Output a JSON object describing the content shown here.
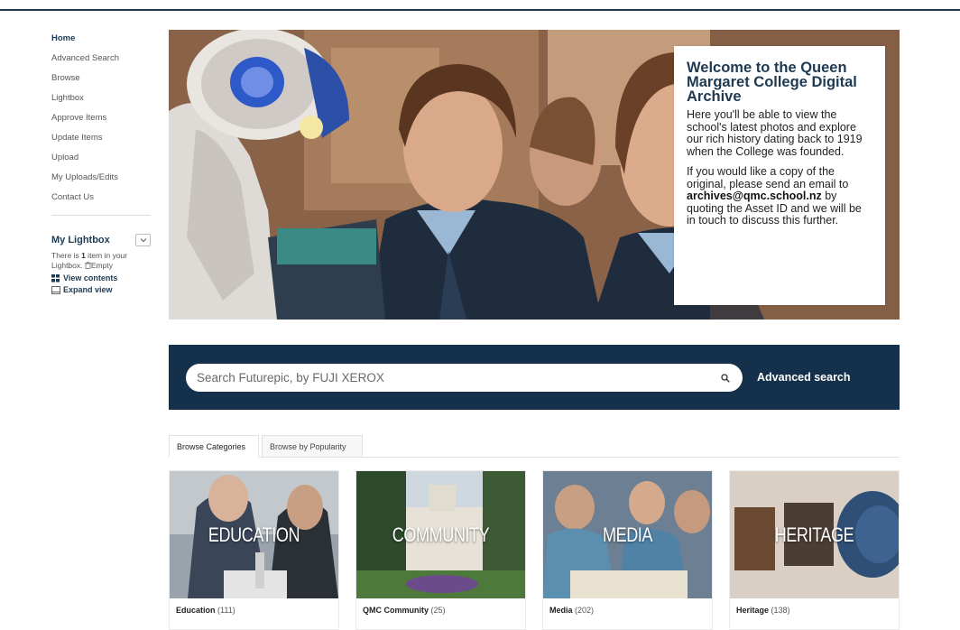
{
  "sidebar": {
    "nav": [
      {
        "label": "Home",
        "active": true
      },
      {
        "label": "Advanced Search",
        "active": false
      },
      {
        "label": "Browse",
        "active": false
      },
      {
        "label": "Lightbox",
        "active": false
      },
      {
        "label": "Approve Items",
        "active": false
      },
      {
        "label": "Update Items",
        "active": false
      },
      {
        "label": "Upload",
        "active": false
      },
      {
        "label": "My Uploads/Edits",
        "active": false
      },
      {
        "label": "Contact Us",
        "active": false
      }
    ],
    "lightbox": {
      "title": "My Lightbox",
      "text_before": "There is ",
      "count": "1",
      "text_after": " item in your Lightbox.",
      "empty_label": "Empty",
      "view_contents": "View contents",
      "expand_view": "Expand view"
    }
  },
  "welcome": {
    "title": "Welcome to the Queen Margaret College Digital Archive",
    "para1": "Here you'll be able to view the school's latest photos and explore our rich history dating back to 1919 when the College was founded.",
    "para2_before": "If you would like a copy of the original, please send an email to ",
    "email": "archives@qmc.school.nz",
    "para2_after": " by quoting the Asset ID and we will be in touch to discuss this further."
  },
  "search": {
    "placeholder": "Search Futurepic, by FUJI XEROX",
    "advanced_label": "Advanced search"
  },
  "tabs": [
    {
      "label": "Browse Categories",
      "active": true
    },
    {
      "label": "Browse by Popularity",
      "active": false
    }
  ],
  "categories": [
    {
      "caption": "EDUCATION",
      "name": "Education",
      "count": "(111)"
    },
    {
      "caption": "COMMUNITY",
      "name": "QMC Community",
      "count": "(25)"
    },
    {
      "caption": "MEDIA",
      "name": "Media",
      "count": "(202)"
    },
    {
      "caption": "HERITAGE",
      "name": "Heritage",
      "count": "(138)"
    }
  ],
  "colors": {
    "navy": "#14304a",
    "title_navy": "#1d3a52"
  },
  "icons": {
    "search": "search-icon",
    "lightbox_toggle": "chevron-down-icon",
    "empty": "trash-icon",
    "view_contents": "grid-icon",
    "expand_view": "window-icon"
  }
}
